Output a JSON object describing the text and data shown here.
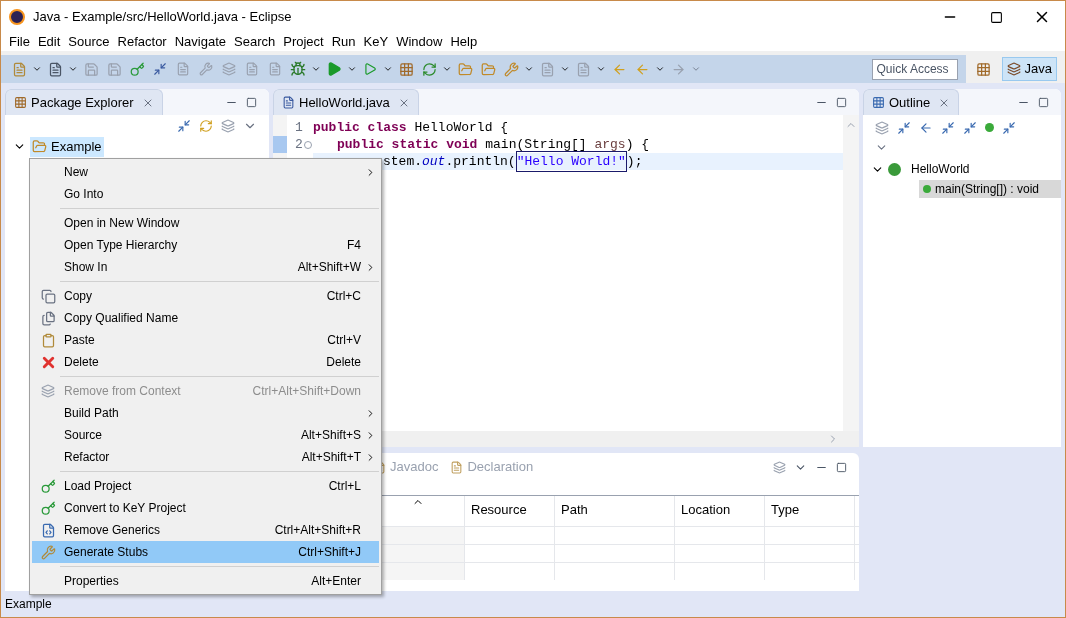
{
  "window": {
    "title": "Java - Example/src/HelloWorld.java - Eclipse"
  },
  "menu_bar": [
    "File",
    "Edit",
    "Source",
    "Refactor",
    "Navigate",
    "Search",
    "Project",
    "Run",
    "KeY",
    "Window",
    "Help"
  ],
  "toolbar": {
    "quick_access": {
      "placeholder": "Quick Access"
    },
    "perspective": {
      "label": "Java",
      "selected": true
    }
  },
  "package_explorer": {
    "tab": {
      "label": "Package Explorer",
      "selected": true
    },
    "tree": [
      {
        "label": "Example",
        "expanded": true,
        "selected": true
      }
    ]
  },
  "editor": {
    "tab": {
      "label": "HelloWorld.java",
      "selected": true
    },
    "lines": [
      {
        "number": "1",
        "current": false,
        "tokens": [
          {
            "kind": "keyword",
            "text": "public class"
          },
          {
            "kind": "plain",
            "text": "HelloWorld {"
          }
        ]
      },
      {
        "number": "2",
        "current": false,
        "tokens": [
          {
            "kind": "keyword",
            "text": "public static void"
          },
          {
            "kind": "plain",
            "text": "main(String[]"
          },
          {
            "kind": "param",
            "text": "args"
          },
          {
            "kind": "plain",
            "text": ") {"
          }
        ]
      },
      {
        "current": true,
        "tokens": [
          {
            "kind": "plain",
            "text": "stem."
          },
          {
            "kind": "field",
            "text": "out"
          },
          {
            "kind": "plain",
            "text": ".println("
          },
          {
            "kind": "string",
            "text": "\"Hello World!\""
          },
          {
            "kind": "plain",
            "text": ");"
          }
        ]
      }
    ]
  },
  "outline": {
    "tab": {
      "label": "Outline",
      "selected": true
    },
    "tree": [
      {
        "label": "HelloWorld",
        "expanded": true,
        "selected": false,
        "children": [
          {
            "label": "main(String[]) : void",
            "selected": true
          }
        ]
      }
    ]
  },
  "bottom_panel": {
    "tabs": [
      {
        "label": "Javadoc",
        "selected": false
      },
      {
        "label": "Declaration",
        "selected": false
      }
    ],
    "columns": [
      "Resource",
      "Path",
      "Location",
      "Type"
    ]
  },
  "context_menu": {
    "groups": [
      [
        {
          "label": "New",
          "submenu": true,
          "disabled": false,
          "selected": false
        },
        {
          "label": "Go Into",
          "submenu": false,
          "disabled": false,
          "selected": false
        }
      ],
      [
        {
          "label": "Open in New Window",
          "submenu": false,
          "disabled": false,
          "selected": false
        },
        {
          "label": "Open Type Hierarchy",
          "shortcut": "F4",
          "submenu": false,
          "disabled": false,
          "selected": false
        },
        {
          "label": "Show In",
          "shortcut": "Alt+Shift+W",
          "submenu": true,
          "disabled": false,
          "selected": false
        }
      ],
      [
        {
          "label": "Copy",
          "shortcut": "Ctrl+C",
          "submenu": false,
          "disabled": false,
          "selected": false
        },
        {
          "label": "Copy Qualified Name",
          "submenu": false,
          "disabled": false,
          "selected": false
        },
        {
          "label": "Paste",
          "shortcut": "Ctrl+V",
          "submenu": false,
          "disabled": false,
          "selected": false
        },
        {
          "label": "Delete",
          "shortcut": "Delete",
          "submenu": false,
          "disabled": false,
          "selected": false
        }
      ],
      [
        {
          "label": "Remove from Context",
          "shortcut": "Ctrl+Alt+Shift+Down",
          "submenu": false,
          "disabled": true,
          "selected": false
        },
        {
          "label": "Build Path",
          "submenu": true,
          "disabled": false,
          "selected": false
        },
        {
          "label": "Source",
          "shortcut": "Alt+Shift+S",
          "submenu": true,
          "disabled": false,
          "selected": false
        },
        {
          "label": "Refactor",
          "shortcut": "Alt+Shift+T",
          "submenu": true,
          "disabled": false,
          "selected": false
        }
      ],
      [
        {
          "label": "Load Project",
          "shortcut": "Ctrl+L",
          "submenu": false,
          "disabled": false,
          "selected": false
        },
        {
          "label": "Convert to KeY Project",
          "submenu": false,
          "disabled": false,
          "selected": false
        },
        {
          "label": "Remove Generics",
          "shortcut": "Ctrl+Alt+Shift+R",
          "submenu": false,
          "disabled": false,
          "selected": false
        },
        {
          "label": "Generate Stubs",
          "shortcut": "Ctrl+Shift+J",
          "submenu": false,
          "disabled": false,
          "selected": true
        }
      ],
      [
        {
          "label": "Properties",
          "shortcut": "Alt+Enter",
          "submenu": false,
          "disabled": false,
          "selected": false
        }
      ]
    ]
  },
  "status_bar": {
    "text": "Example"
  }
}
